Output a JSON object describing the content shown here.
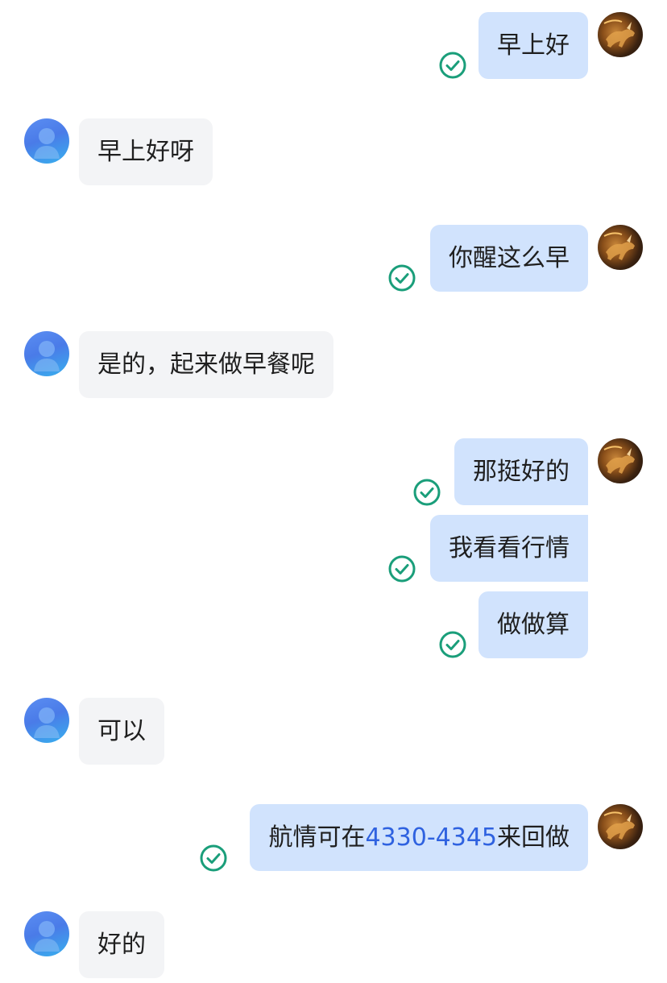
{
  "messages": [
    {
      "side": "out",
      "text": "早上好"
    },
    {
      "side": "in",
      "text": "早上好呀"
    },
    {
      "side": "out",
      "text": "你醒这么早"
    },
    {
      "side": "in",
      "text": "是的，起来做早餐呢"
    },
    {
      "side": "out",
      "text": "那挺好的"
    },
    {
      "side": "out",
      "text": "我看看行情"
    },
    {
      "side": "out",
      "text": "做做算"
    },
    {
      "side": "in",
      "text": "可以"
    },
    {
      "side": "out",
      "text_before": "航情可在",
      "text_highlight": "4330-4345",
      "text_after": "来回做"
    },
    {
      "side": "in",
      "text": "好的"
    }
  ],
  "colors": {
    "outgoing_bubble": "#d1e3fd",
    "incoming_bubble": "#f3f4f6",
    "check": "#1a9e7a",
    "highlight": "#2f62e0"
  },
  "icons": {
    "sent_status": "check-circle-icon",
    "self_avatar": "bull-avatar",
    "contact_avatar": "person-avatar"
  }
}
